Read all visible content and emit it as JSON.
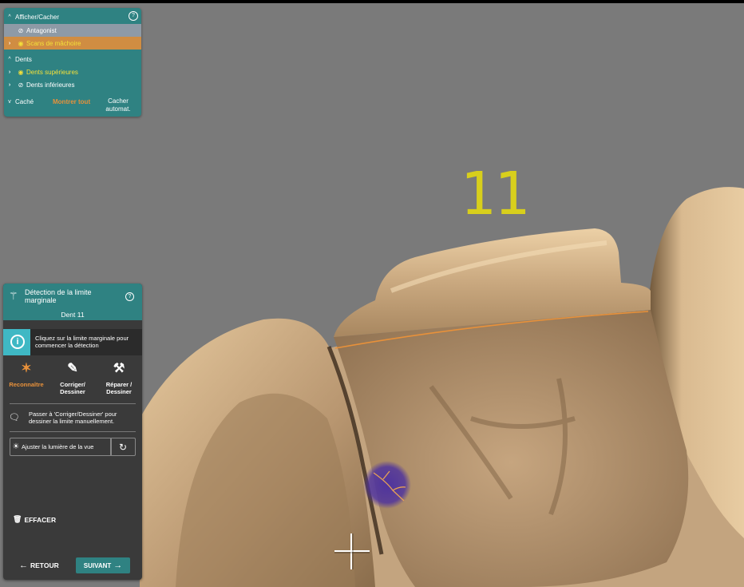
{
  "viewport": {
    "tooth_number": "11"
  },
  "visibility_panel": {
    "title": "Afficher/Cacher",
    "items": [
      {
        "label": "Antagonist",
        "icon": "eye-off-icon"
      },
      {
        "label": "Scans de mâchoire",
        "icon": "eye-icon"
      }
    ],
    "teeth_section": "Dents",
    "teeth_items": [
      {
        "label": "Dents supérieures",
        "icon": "eye-icon"
      },
      {
        "label": "Dents inférieures",
        "icon": "eye-off-icon"
      }
    ],
    "hidden_label": "Caché",
    "show_all": "Montrer tout",
    "auto_hide_1": "Cacher",
    "auto_hide_2": "automat."
  },
  "margin_panel": {
    "title_line1": "Détection de la limite",
    "title_line2": "marginale",
    "tooth": "Dent 11",
    "info_line1": "Cliquez sur la limite marginale pour",
    "info_line2": "commencer la détection",
    "tools": [
      {
        "l1": "Reconnaître",
        "l2": ""
      },
      {
        "l1": "Corriger/",
        "l2": "Dessiner"
      },
      {
        "l1": "Réparer /",
        "l2": "Dessiner"
      }
    ],
    "hint_line1": "Passer à 'Corriger/Dessiner' pour",
    "hint_line2": "dessiner la limite manuellement.",
    "light_label": "Ajuster la lumière de la vue",
    "clear_label": "EFFACER",
    "back_label": "RETOUR",
    "next_label": "SUIVANT"
  },
  "colors": {
    "teal": "#2f8282",
    "accent_orange": "#e8913a",
    "highlight_yellow": "#f3e03a",
    "tooth_label": "#d8cf1c",
    "info_cyan": "#3fb8c4"
  }
}
